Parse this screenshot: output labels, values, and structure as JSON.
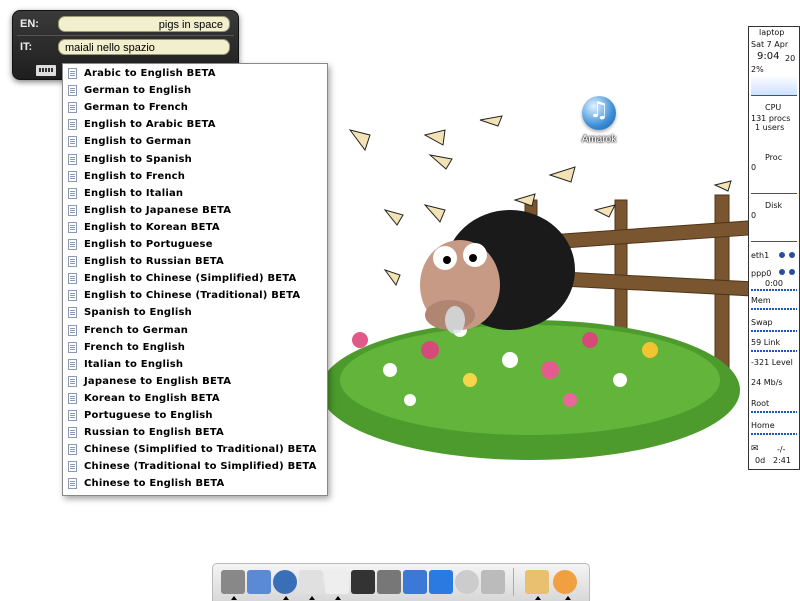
{
  "translator": {
    "en_label": "EN:",
    "en_value": "pigs in space",
    "it_label": "IT:",
    "it_value": "maiali nello spazio"
  },
  "menu": {
    "items": [
      "Arabic to English BETA",
      "German to English",
      "German to French",
      "English to Arabic BETA",
      "English to German",
      "English to Spanish",
      "English to French",
      "English to Italian",
      "English to Japanese BETA",
      "English to Korean BETA",
      "English to Portuguese",
      "English to Russian BETA",
      "English to Chinese (Simplified) BETA",
      "English to Chinese (Traditional) BETA",
      "Spanish to English",
      "French to German",
      "French to English",
      "Italian to English",
      "Japanese to English BETA",
      "Korean to English BETA",
      "Portuguese to English",
      "Russian to English BETA",
      "Chinese (Simplified to Traditional) BETA",
      "Chinese (Traditional to Simplified) BETA",
      "Chinese to English BETA"
    ]
  },
  "desktop": {
    "amarok_label": "Amarok"
  },
  "monitor": {
    "host": "laptop",
    "date": "Sat  7  Apr",
    "time": "9:04",
    "seconds": "20",
    "cpu_pct": "2%",
    "cpu_label": "CPU",
    "procs": "131 procs",
    "users": "1 users",
    "proc_label": "Proc",
    "proc_val": "0",
    "disk_label": "Disk",
    "disk_val": "0",
    "eth": "eth1",
    "ppp": "ppp0",
    "ppp_time": "0:00",
    "mem_label": "Mem",
    "swap_label": "Swap",
    "link": "59 Link",
    "level": "-321 Level",
    "rate": "24 Mb/s",
    "root_label": "Root",
    "home_label": "Home",
    "mail": "-/-",
    "uptime_d": "0d",
    "uptime_t": "2:41"
  },
  "dock": {
    "icons": [
      "terminal-icon",
      "gimp-icon",
      "safari-compass-icon",
      "paper-icon",
      "paper-shuffle-icon",
      "photo-icon",
      "coffee-icon",
      "waves-icon",
      "calendar-icon",
      "clock-icon",
      "cloud-icon",
      "key-icon",
      "globe-icon"
    ]
  }
}
